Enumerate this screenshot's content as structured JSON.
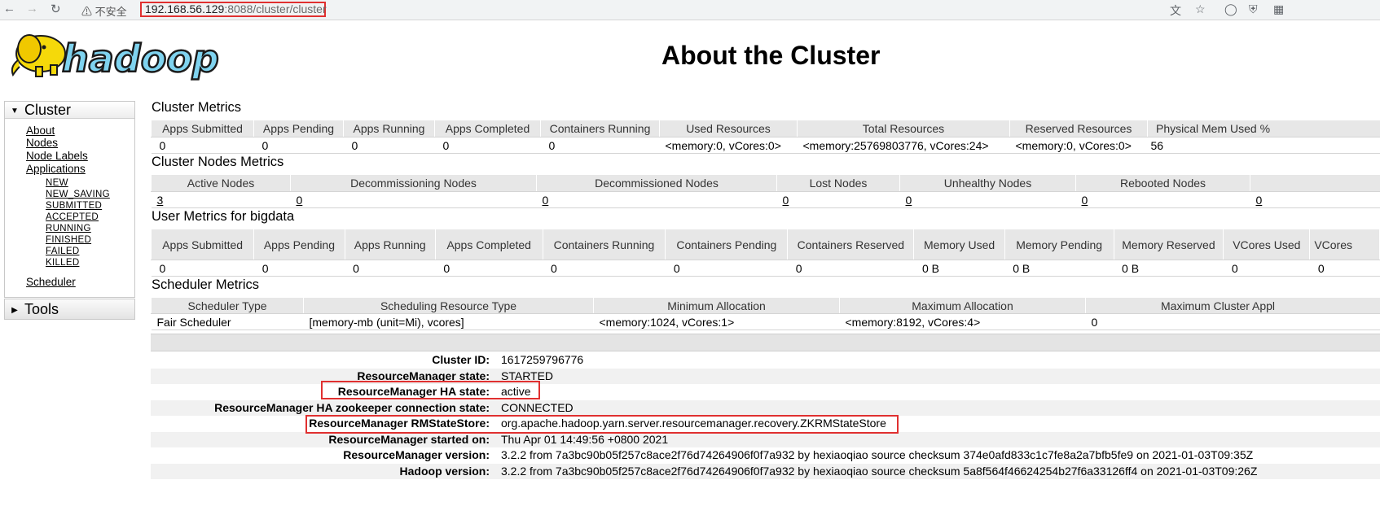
{
  "browser": {
    "security_label": "不安全",
    "url_host": "192.168.56.129",
    "url_rest": ":8088/cluster/cluster"
  },
  "header": {
    "title": "About the Cluster",
    "logo_text": "hadoop"
  },
  "nav": {
    "cluster_label": "Cluster",
    "about": "About",
    "nodes": "Nodes",
    "node_labels": "Node Labels",
    "applications": "Applications",
    "app_states": [
      "NEW",
      "NEW_SAVING",
      "SUBMITTED",
      "ACCEPTED",
      "RUNNING",
      "FINISHED",
      "FAILED",
      "KILLED"
    ],
    "scheduler": "Scheduler",
    "tools_label": "Tools"
  },
  "cluster_metrics": {
    "title": "Cluster Metrics",
    "headers": [
      "Apps Submitted",
      "Apps Pending",
      "Apps Running",
      "Apps Completed",
      "Containers Running",
      "Used Resources",
      "Total Resources",
      "Reserved Resources",
      "Physical Mem Used %"
    ],
    "values": [
      "0",
      "0",
      "0",
      "0",
      "0",
      "<memory:0, vCores:0>",
      "<memory:25769803776, vCores:24>",
      "<memory:0, vCores:0>",
      "56"
    ]
  },
  "node_metrics": {
    "title": "Cluster Nodes Metrics",
    "headers": [
      "Active Nodes",
      "Decommissioning Nodes",
      "Decommissioned Nodes",
      "Lost Nodes",
      "Unhealthy Nodes",
      "Rebooted Nodes"
    ],
    "values": [
      "3",
      "0",
      "0",
      "0",
      "0",
      "0",
      "0"
    ]
  },
  "user_metrics": {
    "title": "User Metrics for bigdata",
    "headers": [
      "Apps Submitted",
      "Apps Pending",
      "Apps Running",
      "Apps Completed",
      "Containers Running",
      "Containers Pending",
      "Containers Reserved",
      "Memory Used",
      "Memory Pending",
      "Memory Reserved",
      "VCores Used",
      "VCores"
    ],
    "values": [
      "0",
      "0",
      "0",
      "0",
      "0",
      "0",
      "0",
      "0 B",
      "0 B",
      "0 B",
      "0",
      "0"
    ]
  },
  "scheduler_metrics": {
    "title": "Scheduler Metrics",
    "headers": [
      "Scheduler Type",
      "Scheduling Resource Type",
      "Minimum Allocation",
      "Maximum Allocation",
      "Maximum Cluster Appl"
    ],
    "values": [
      "Fair Scheduler",
      "[memory-mb (unit=Mi), vcores]",
      "<memory:1024, vCores:1>",
      "<memory:8192, vCores:4>",
      "0"
    ]
  },
  "cluster_info": [
    {
      "label": "Cluster ID:",
      "value": "1617259796776"
    },
    {
      "label": "ResourceManager state:",
      "value": "STARTED"
    },
    {
      "label": "ResourceManager HA state:",
      "value": "active"
    },
    {
      "label": "ResourceManager HA zookeeper connection state:",
      "value": "CONNECTED"
    },
    {
      "label": "ResourceManager RMStateStore:",
      "value": "org.apache.hadoop.yarn.server.resourcemanager.recovery.ZKRMStateStore"
    },
    {
      "label": "ResourceManager started on:",
      "value": "Thu Apr 01 14:49:56 +0800 2021"
    },
    {
      "label": "ResourceManager version:",
      "value": "3.2.2 from 7a3bc90b05f257c8ace2f76d74264906f0f7a932 by hexiaoqiao source checksum 374e0afd833c1c7fe8a2a7bfb5fe9 on 2021-01-03T09:35Z"
    },
    {
      "label": "Hadoop version:",
      "value": "3.2.2 from 7a3bc90b05f257c8ace2f76d74264906f0f7a932 by hexiaoqiao source checksum 5a8f564f46624254b27f6a33126ff4 on 2021-01-03T09:26Z"
    }
  ],
  "colors": {
    "highlight": "#e03030",
    "logo_fill": "#7fd3ef",
    "elephant": "#f5d90a"
  }
}
